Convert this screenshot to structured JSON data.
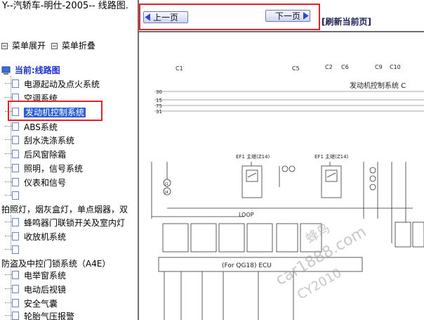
{
  "left_frame": {
    "title": "Y--汽轿车-明仕-2005-- 线路图.",
    "toggle_expand": "菜单展开",
    "toggle_collapse": "菜单折叠",
    "root": "当前:线路图",
    "items": [
      {
        "label": "电源起动及点火系统"
      },
      {
        "label": "空调系统"
      },
      {
        "label": "发动机控制系统",
        "selected": true
      },
      {
        "label": "ABS系统"
      },
      {
        "label": "刮水洗涤系统"
      },
      {
        "label": "后风窗除霜"
      },
      {
        "label": "照明，信号系统"
      },
      {
        "label": "仪表和信号"
      },
      {
        "label": ""
      },
      {
        "label": "拍照灯，烟灰盒灯，单点烟器，双"
      },
      {
        "label": "蜂鸣器门联锁开关及室内灯"
      },
      {
        "label": "收放机系统"
      },
      {
        "label": ""
      },
      {
        "label": "防盗及中控门锁系统（A4E）"
      },
      {
        "label": "电举窗系统"
      },
      {
        "label": "电动后视镜"
      },
      {
        "label": "安全气囊"
      },
      {
        "label": "轮胎气压报警"
      }
    ]
  },
  "right_frame": {
    "prev_page": "上一页",
    "next_page": "下一页",
    "refresh": "[刷新当前页]",
    "diagram": {
      "system_title": "发动机控制系统 C",
      "col_labels": [
        "C1",
        "C5",
        "C2",
        "C6",
        "C9",
        "C10"
      ],
      "row_labels": [
        "30",
        "15",
        "75",
        "31"
      ],
      "fuse_left": "EF1 主继(Z14)",
      "fuse_right": "EF1 主继(Z14)",
      "loop_label": "LOOP",
      "ecu_label": "(For QG18) ECU",
      "junctions": [
        "J1",
        "J4"
      ],
      "watermarks": [
        "蜂鸟",
        "car1888.com",
        "CY2010"
      ]
    }
  }
}
